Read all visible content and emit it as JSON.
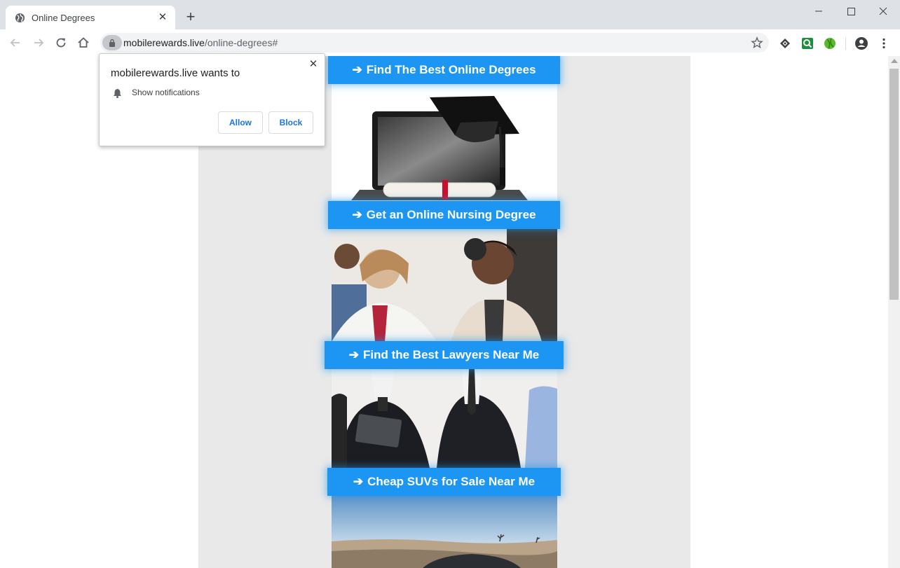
{
  "browser": {
    "tab": {
      "title": "Online Degrees",
      "close_glyph": "✕"
    },
    "new_tab_glyph": "+",
    "url": {
      "host": "mobilerewards.live",
      "path": "/online-degrees#"
    }
  },
  "popup": {
    "title": "mobilerewards.live wants to",
    "permission": "Show notifications",
    "allow": "Allow",
    "block": "Block",
    "close_glyph": "✕"
  },
  "ads": [
    {
      "arrow": "➔",
      "label": "Find The Best Online Degrees"
    },
    {
      "arrow": "➔",
      "label": "Get an Online Nursing Degree"
    },
    {
      "arrow": "➔",
      "label": "Find the Best Lawyers Near Me"
    },
    {
      "arrow": "➔",
      "label": "Cheap SUVs for Sale Near Me"
    }
  ],
  "colors": {
    "cta": "#1d96f3",
    "chrome": "#dee1e6",
    "page_gray": "#e9e9e9"
  },
  "icons": [
    "globe-icon",
    "close-icon",
    "plus-icon",
    "minimize-icon",
    "maximize-icon",
    "window-close-icon",
    "back-icon",
    "forward-icon",
    "reload-icon",
    "home-icon",
    "lock-icon",
    "star-icon",
    "extension-icon",
    "profile-icon",
    "menu-icon",
    "bell-icon",
    "arrow-right-icon"
  ]
}
